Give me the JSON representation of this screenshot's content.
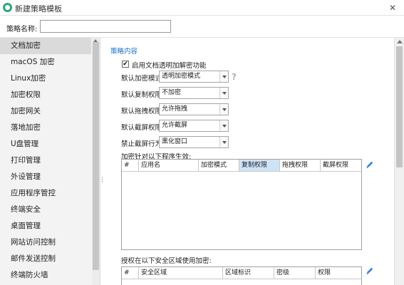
{
  "window": {
    "title": "新建策略模板",
    "close_glyph": "✕"
  },
  "policy_name": {
    "label": "策略名称:",
    "value": ""
  },
  "sidebar": {
    "items": [
      {
        "label": "文档加密",
        "active": true
      },
      {
        "label": "macOS 加密"
      },
      {
        "label": "Linux加密"
      },
      {
        "label": "加密权限"
      },
      {
        "label": "加密网关"
      },
      {
        "label": "落地加密"
      },
      {
        "label": "U盘管理"
      },
      {
        "label": "打印管理"
      },
      {
        "label": "外设管理"
      },
      {
        "label": "应用程序管控"
      },
      {
        "label": "终端安全"
      },
      {
        "label": "桌面管理"
      },
      {
        "label": "网站访问控制"
      },
      {
        "label": "邮件发送控制"
      },
      {
        "label": "终端防火墙"
      }
    ]
  },
  "main": {
    "section_title": "策略内容",
    "enable_checkbox": {
      "label": "启用文档透明加解密功能",
      "checked": true,
      "check_glyph": "✔"
    },
    "fields": [
      {
        "label": "默认加密模式",
        "value": "透明加密模式"
      },
      {
        "label": "默认复制权限",
        "value": "不加密"
      },
      {
        "label": "默认拖拽权限",
        "value": "允许拖拽"
      },
      {
        "label": "默认截屏权限",
        "value": "允许截屏"
      },
      {
        "label": "禁止截屏行为",
        "value": "黑化窗口"
      }
    ],
    "help_glyph": "?",
    "program_grid": {
      "label": "加密针对以下程序生效:",
      "columns": [
        "#",
        "应用名",
        "加密模式",
        "复制权限",
        "拖拽权限",
        "截屏权限"
      ],
      "selected_column": 3
    },
    "area_grid": {
      "label": "授权在以下安全区域使用加密:",
      "columns": [
        "#",
        "安全区域",
        "区域标识",
        "密级",
        "权限"
      ]
    }
  },
  "colors": {
    "accent": "#1f6fc9",
    "logo": "#2aa77e",
    "selected_header": "#cfe3f7"
  }
}
